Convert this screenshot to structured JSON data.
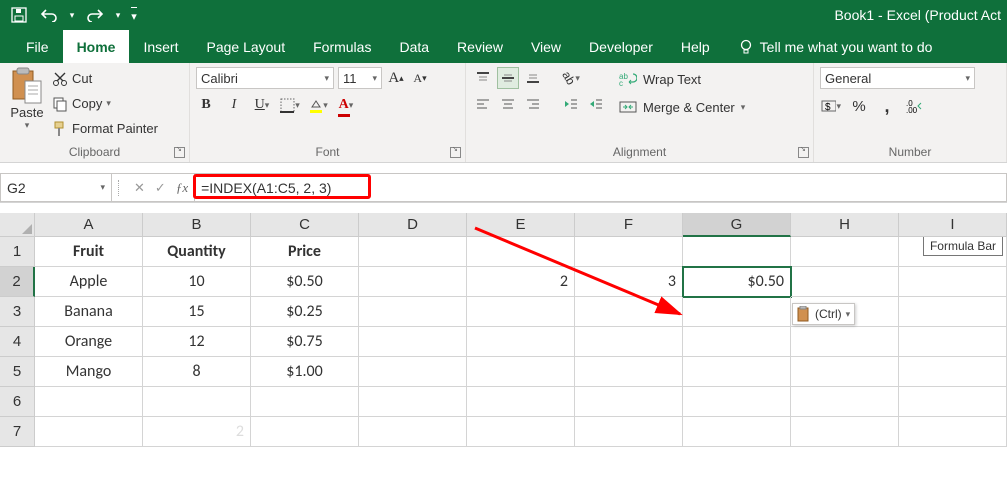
{
  "app": {
    "title": "Book1  -  Excel (Product Act"
  },
  "tabs": {
    "file": "File",
    "home": "Home",
    "insert": "Insert",
    "pagelayout": "Page Layout",
    "formulas": "Formulas",
    "data": "Data",
    "review": "Review",
    "view": "View",
    "developer": "Developer",
    "help": "Help",
    "tellme": "Tell me what you want to do"
  },
  "clipboard": {
    "paste": "Paste",
    "cut": "Cut",
    "copy": "Copy",
    "painter": "Format Painter",
    "group": "Clipboard"
  },
  "font": {
    "name": "Calibri",
    "size": "11",
    "group": "Font"
  },
  "alignment": {
    "wrap": "Wrap Text",
    "merge": "Merge & Center",
    "group": "Alignment"
  },
  "number": {
    "format": "General",
    "group": "Number",
    "pct": "%",
    "comma": ","
  },
  "fx": {
    "cellref": "G2",
    "formula": "=INDEX(A1:C5, 2, 3)",
    "tooltip": "Formula Bar"
  },
  "sheet": {
    "cols": [
      "A",
      "B",
      "C",
      "D",
      "E",
      "F",
      "G",
      "H",
      "I"
    ],
    "rows": [
      {
        "n": "1",
        "cells": {
          "A": "Fruit",
          "B": "Quantity",
          "C": "Price"
        }
      },
      {
        "n": "2",
        "cells": {
          "A": "Apple",
          "B": "10",
          "C": "$0.50",
          "E": "2",
          "F": "3",
          "G": "$0.50"
        }
      },
      {
        "n": "3",
        "cells": {
          "A": "Banana",
          "B": "15",
          "C": "$0.25"
        }
      },
      {
        "n": "4",
        "cells": {
          "A": "Orange",
          "B": "12",
          "C": "$0.75"
        }
      },
      {
        "n": "5",
        "cells": {
          "A": "Mango",
          "B": "8",
          "C": "$1.00"
        }
      },
      {
        "n": "6",
        "cells": {}
      },
      {
        "n": "7",
        "cells": {
          "B_phantom": "2"
        }
      }
    ],
    "pasteopts": "(Ctrl)"
  }
}
